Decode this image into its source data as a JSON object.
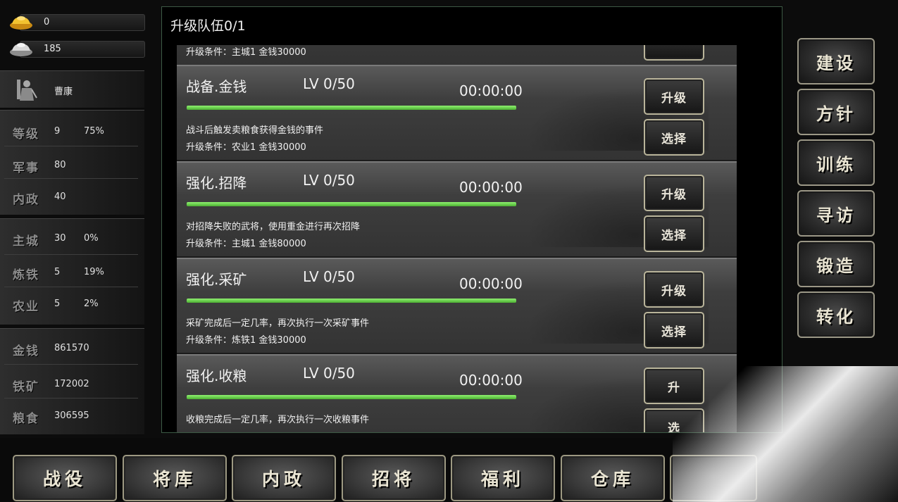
{
  "currency": {
    "gold": "0",
    "silver": "185"
  },
  "player": {
    "name": "曹康"
  },
  "stats": [
    {
      "label": "等级",
      "value": "9",
      "extra": "75%"
    },
    {
      "label": "军事",
      "value": "80",
      "extra": ""
    },
    {
      "label": "内政",
      "value": "40",
      "extra": ""
    }
  ],
  "buildings": [
    {
      "label": "主城",
      "value": "30",
      "extra": "0%"
    },
    {
      "label": "炼铁",
      "value": "5",
      "extra": "19%"
    },
    {
      "label": "农业",
      "value": "5",
      "extra": "2%"
    }
  ],
  "resources": [
    {
      "label": "金钱",
      "value": "861570"
    },
    {
      "label": "铁矿",
      "value": "172002"
    },
    {
      "label": "粮食",
      "value": "306595"
    }
  ],
  "main": {
    "title": "升级队伍0/1",
    "partial_condition": "升级条件：主城1 金钱30000",
    "cards": [
      {
        "name": "战备.金钱",
        "level": "LV 0/50",
        "timer": "00:00:00",
        "progress": 1.0,
        "desc": "战斗后触发卖粮食获得金钱的事件",
        "condition": "升级条件：农业1 金钱30000",
        "upgrade_label": "升级",
        "select_label": "选择"
      },
      {
        "name": "强化.招降",
        "level": "LV 0/50",
        "timer": "00:00:00",
        "progress": 1.0,
        "desc": "对招降失败的武将，使用重金进行再次招降",
        "condition": "升级条件：主城1 金钱80000",
        "upgrade_label": "升级",
        "select_label": "选择"
      },
      {
        "name": "强化.采矿",
        "level": "LV 0/50",
        "timer": "00:00:00",
        "progress": 1.0,
        "desc": "采矿完成后一定几率，再次执行一次采矿事件",
        "condition": "升级条件：炼铁1 金钱30000",
        "upgrade_label": "升级",
        "select_label": "选择"
      },
      {
        "name": "强化.收粮",
        "level": "LV 0/50",
        "timer": "00:00:00",
        "progress": 1.0,
        "desc": "收粮完成后一定几率，再次执行一次收粮事件",
        "condition": "",
        "upgrade_label": "升",
        "select_label": "选"
      }
    ]
  },
  "right_menu": [
    "建设",
    "方针",
    "训练",
    "寻访",
    "锻造",
    "转化"
  ],
  "bottom_menu": [
    "战役",
    "将库",
    "内政",
    "招将",
    "福利",
    "仓库"
  ],
  "colors": {
    "progress": "#6fd94a",
    "button_border": "#b9b49a",
    "window_border": "#3d5a45"
  }
}
